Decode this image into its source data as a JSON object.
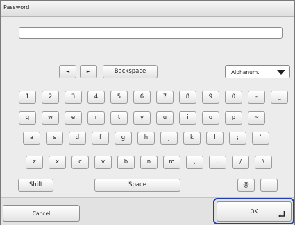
{
  "window": {
    "title": "Password"
  },
  "password": {
    "value": ""
  },
  "nav": {
    "left_arrow": "◄",
    "right_arrow": "►",
    "backspace": "Backspace"
  },
  "mode_select": {
    "value": "Alphanum."
  },
  "rows": [
    [
      "1",
      "2",
      "3",
      "4",
      "5",
      "6",
      "7",
      "8",
      "9",
      "0",
      "-",
      "_"
    ],
    [
      "q",
      "w",
      "e",
      "r",
      "t",
      "y",
      "u",
      "i",
      "o",
      "p",
      "~"
    ],
    [
      "a",
      "s",
      "d",
      "f",
      "g",
      "h",
      "j",
      "k",
      "l",
      ";",
      "'"
    ],
    [
      "z",
      "x",
      "c",
      "v",
      "b",
      "n",
      "m",
      ",",
      ".",
      "/",
      "\\"
    ]
  ],
  "bottom_keys": {
    "shift": "Shift",
    "space": "Space",
    "at": "@",
    "dot": "."
  },
  "footer": {
    "cancel": "Cancel",
    "ok": "OK"
  },
  "colors": {
    "focus": "#1b3db5",
    "window_bg": "#ececec"
  }
}
